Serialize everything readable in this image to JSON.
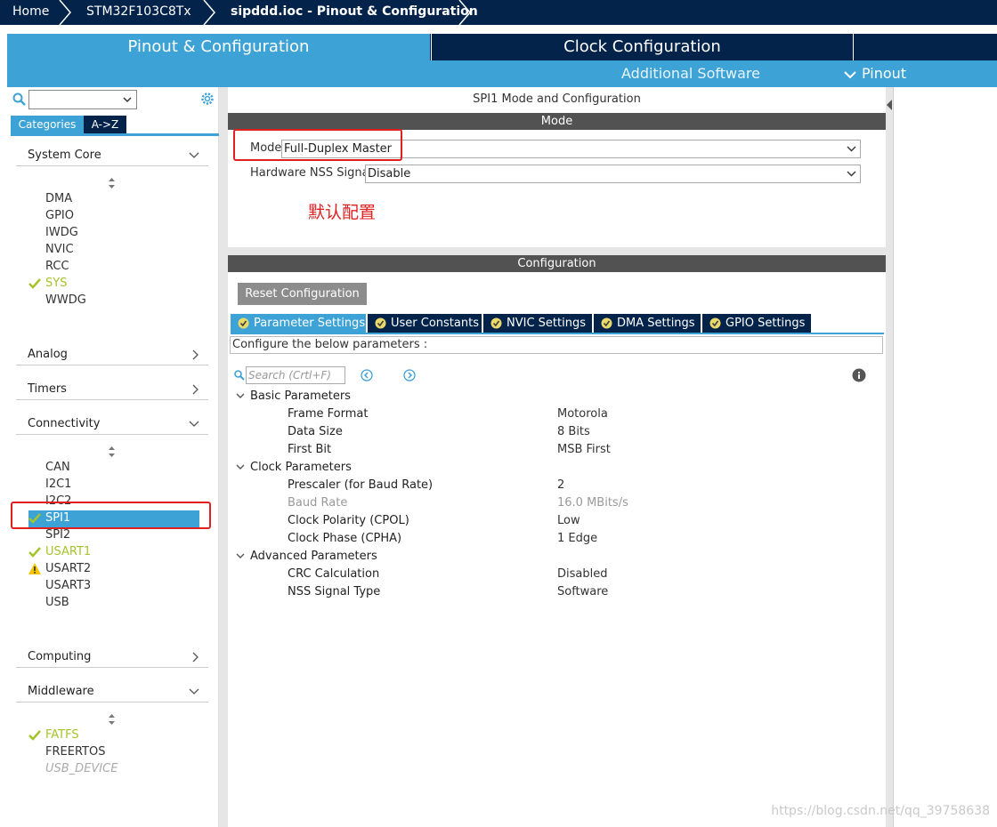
{
  "breadcrumb": {
    "home": "Home",
    "device": "STM32F103C8Tx",
    "file": "sipddd.ioc - Pinout & Configuration"
  },
  "tabs": {
    "pinout": "Pinout & Configuration",
    "clock": "Clock Configuration"
  },
  "subbar": {
    "additional": "Additional Software",
    "pinout": "Pinout"
  },
  "left": {
    "search_value": "",
    "tab_categories": "Categories",
    "tab_az": "A->Z",
    "categories": {
      "system_core": "System Core",
      "analog": "Analog",
      "timers": "Timers",
      "connectivity": "Connectivity",
      "computing": "Computing",
      "middleware": "Middleware"
    },
    "system_core_items": [
      "DMA",
      "GPIO",
      "IWDG",
      "NVIC",
      "RCC",
      "SYS",
      "WWDG"
    ],
    "connectivity_items": [
      "CAN",
      "I2C1",
      "I2C2",
      "SPI1",
      "SPI2",
      "USART1",
      "USART2",
      "USART3",
      "USB"
    ],
    "middleware_items": [
      "FATFS",
      "FREERTOS",
      "USB_DEVICE"
    ]
  },
  "main": {
    "title": "SPI1 Mode and Configuration",
    "mode_bar": "Mode",
    "mode_label": "Mode",
    "mode_value": "Full-Duplex Master",
    "nss_label": "Hardware NSS Signal",
    "nss_value": "Disable",
    "note": "默认配置",
    "config_bar": "Configuration",
    "reset_label": "Reset Configuration",
    "cfg_tabs": [
      "Parameter Settings",
      "User Constants",
      "NVIC Settings",
      "DMA Settings",
      "GPIO Settings"
    ],
    "cfg_note": "Configure the below parameters :",
    "search_placeholder": "Search (Crtl+F)",
    "groups": {
      "basic": "Basic Parameters",
      "clock": "Clock Parameters",
      "advanced": "Advanced Parameters"
    },
    "params": [
      {
        "name": "Frame Format",
        "value": "Motorola"
      },
      {
        "name": "Data Size",
        "value": "8 Bits"
      },
      {
        "name": "First Bit",
        "value": "MSB First"
      },
      {
        "name": "Prescaler (for Baud Rate)",
        "value": "2"
      },
      {
        "name": "Baud Rate",
        "value": "16.0 MBits/s"
      },
      {
        "name": "Clock Polarity (CPOL)",
        "value": "Low"
      },
      {
        "name": "Clock Phase (CPHA)",
        "value": "1 Edge"
      },
      {
        "name": "CRC Calculation",
        "value": "Disabled"
      },
      {
        "name": "NSS Signal Type",
        "value": "Software"
      }
    ]
  },
  "watermark": "https://blog.csdn.net/qq_39758638",
  "colors": {
    "navy": "#03234b",
    "accent": "#3da2d5",
    "enabled_green": "#a5c42b",
    "warning": "#f5c400",
    "highlight": "#e02020"
  }
}
